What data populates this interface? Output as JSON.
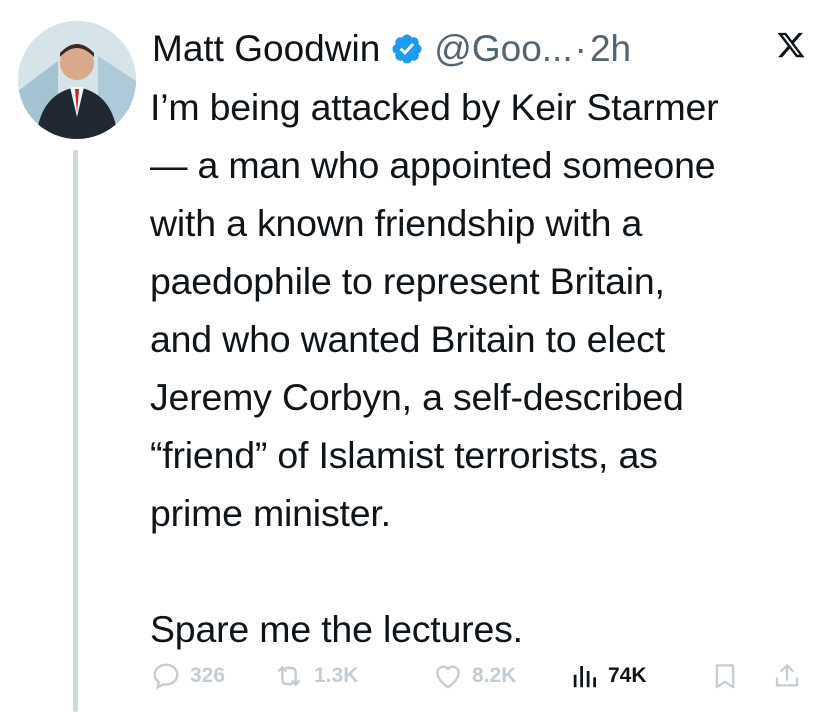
{
  "tweet": {
    "author_name": "Matt Goodwin",
    "handle": "@Goo...",
    "separator": "·",
    "time": "2h",
    "text": "I’m being attacked by Keir Starmer\n— a man who appointed someone\nwith a known friendship with a\npaedophile to represent Britain,\nand who wanted Britain to elect\nJeremy Corbyn, a self-described\n“friend” of Islamist terrorists, as\nprime minister.\n\nSpare me the lectures.",
    "stats": {
      "replies": "326",
      "retweets": "1.3K",
      "likes": "8.2K",
      "views": "74K"
    }
  },
  "icons": {
    "verified": "verified-badge-icon",
    "platform": "x-logo-icon",
    "reply": "reply-icon",
    "retweet": "retweet-icon",
    "like": "heart-icon",
    "views": "views-chart-icon",
    "bookmark": "bookmark-icon",
    "share": "share-icon"
  },
  "colors": {
    "verified_blue": "#1d9bf0",
    "text": "#0f1419",
    "muted": "#536471",
    "faded_action": "#c4cdd3",
    "thread_line": "#cfd9de"
  }
}
